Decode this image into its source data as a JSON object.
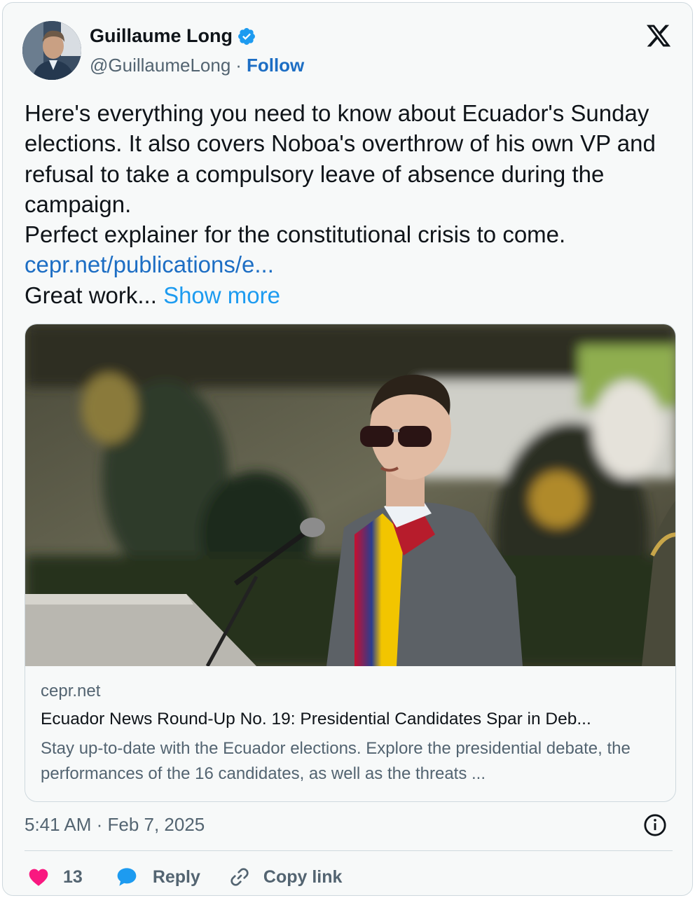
{
  "author": {
    "name": "Guillaume Long",
    "handle": "@GuillaumeLong",
    "separator": "·",
    "follow_label": "Follow"
  },
  "tweet": {
    "text": "Here's everything you need to know about Ecuador's Sunday elections. It also covers Noboa's overthrow of his own VP and refusal to take a compulsory leave of absence during the campaign.\nPerfect explainer for the constitutional crisis to come.",
    "link_text": "cepr.net/publications/e...",
    "trailing_text": "Great work...",
    "show_more_label": "Show more"
  },
  "link_card": {
    "domain": "cepr.net",
    "title": "Ecuador News Round-Up No. 19: Presidential Candidates Spar in Deb...",
    "description": "Stay up-to-date with the Ecuador elections. Explore the presidential debate, the performances of the 16 candidates, as well as the threats ..."
  },
  "timestamp": "5:41 AM · Feb 7, 2025",
  "actions": {
    "like_count": "13",
    "reply_label": "Reply",
    "copy_link_label": "Copy link"
  },
  "colors": {
    "link_blue": "#1d6ec4",
    "show_more_blue": "#1d9bf0",
    "like_pink": "#f91880",
    "reply_blue": "#1d9bf0",
    "verified_blue": "#1d9bf0"
  },
  "icons": {
    "verified": "verified-badge-icon",
    "platform": "x-logo-icon",
    "info": "info-icon",
    "like": "heart-icon",
    "reply": "speech-bubble-icon",
    "copy": "link-chain-icon"
  }
}
